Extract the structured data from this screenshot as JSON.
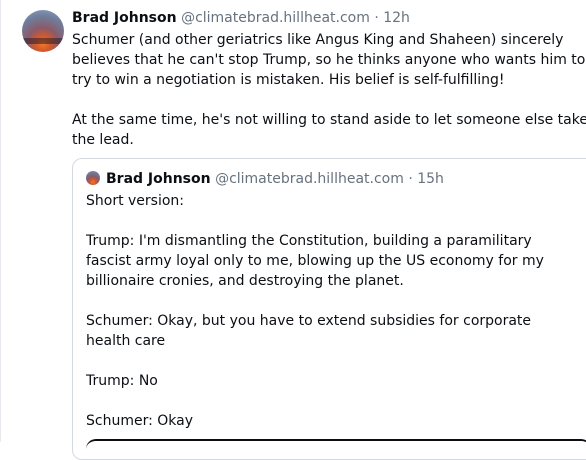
{
  "post": {
    "author_name": "Brad Johnson",
    "author_handle": "@climatebrad.hillheat.com",
    "separator": "·",
    "time": "12h",
    "body_lines": [
      "Schumer (and other geriatrics like Angus King and Shaheen) sincerely",
      "believes that he can't stop Trump, so he thinks anyone who wants him to",
      "try to win a negotiation is mistaken. His belief is self-fulfilling!"
    ],
    "body2_lines": [
      "At the same time, he's not willing to stand aside to let someone else take",
      "the lead."
    ]
  },
  "quote": {
    "author_name": "Brad Johnson",
    "author_handle": "@climatebrad.hillheat.com",
    "separator": "·",
    "time": "15h",
    "line_short": "Short version:",
    "trump1_lines": [
      "Trump: I'm dismantling the Constitution, building a paramilitary",
      "fascist army loyal only to me, blowing up the US economy for my",
      "billionaire cronies, and destroying the planet."
    ],
    "schumer1_lines": [
      "Schumer: Okay, but you have to extend subsidies for corporate",
      "health care"
    ],
    "trump2": "Trump: No",
    "schumer2": "Schumer: Okay"
  }
}
